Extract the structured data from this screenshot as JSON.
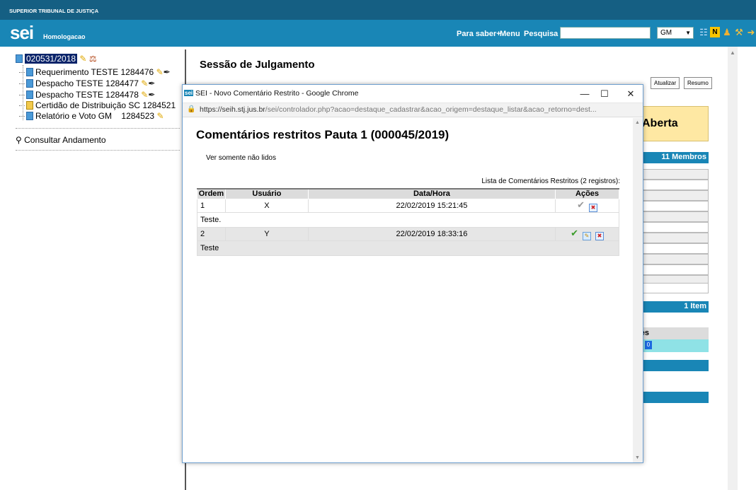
{
  "org": "SUPERIOR TRIBUNAL DE JUSTIÇA",
  "logo": "sei",
  "environment": "Homologacao",
  "nav": {
    "para_saber": "Para saber+",
    "menu": "Menu",
    "pesquisa": "Pesquisa",
    "search_value": "",
    "unit": "GM"
  },
  "tree": {
    "root": "020531/2018",
    "items": [
      {
        "label": "Requerimento TESTE 1284476"
      },
      {
        "label": "Despacho TESTE 1284477"
      },
      {
        "label": "Despacho TESTE 1284478"
      },
      {
        "label": "Certidão de Distribuição SC 1284521"
      },
      {
        "label": "Relatório e Voto GM    1284523"
      }
    ],
    "consult": "Consultar Andamento"
  },
  "main": {
    "title": "Sessão de Julgamento",
    "btn_atualizar": "Atualizar",
    "btn_resumo": "Resumo",
    "status": "Aberta",
    "members": "11 Membros",
    "items": "1 Item",
    "col_partial": "ões",
    "badge": "0"
  },
  "popup": {
    "window_title": "SEI - Novo Comentário Restrito - Google Chrome",
    "favicon": "sei",
    "url_host": "https://seih.stj.jus.br",
    "url_rest": "/sei/controlador.php?acao=destaque_cadastrar&acao_origem=destaque_listar&acao_retorno=dest...",
    "heading": "Comentários restritos Pauta 1 (000045/2019)",
    "filter_link": "Ver somente não lidos",
    "caption": "Lista de Comentários Restritos (2 registros):",
    "columns": {
      "ordem": "Ordem",
      "usuario": "Usuário",
      "datahora": "Data/Hora",
      "acoes": "Ações"
    },
    "rows": [
      {
        "ordem": "1",
        "usuario": "X",
        "datahora": "22/02/2019 15:21:45",
        "comment": "Teste."
      },
      {
        "ordem": "2",
        "usuario": "Y",
        "datahora": "22/02/2019 18:33:16",
        "comment": "Teste"
      }
    ]
  },
  "colors": {
    "header": "#1986b6",
    "topbar": "#155f83",
    "status": "#fee8a3"
  }
}
